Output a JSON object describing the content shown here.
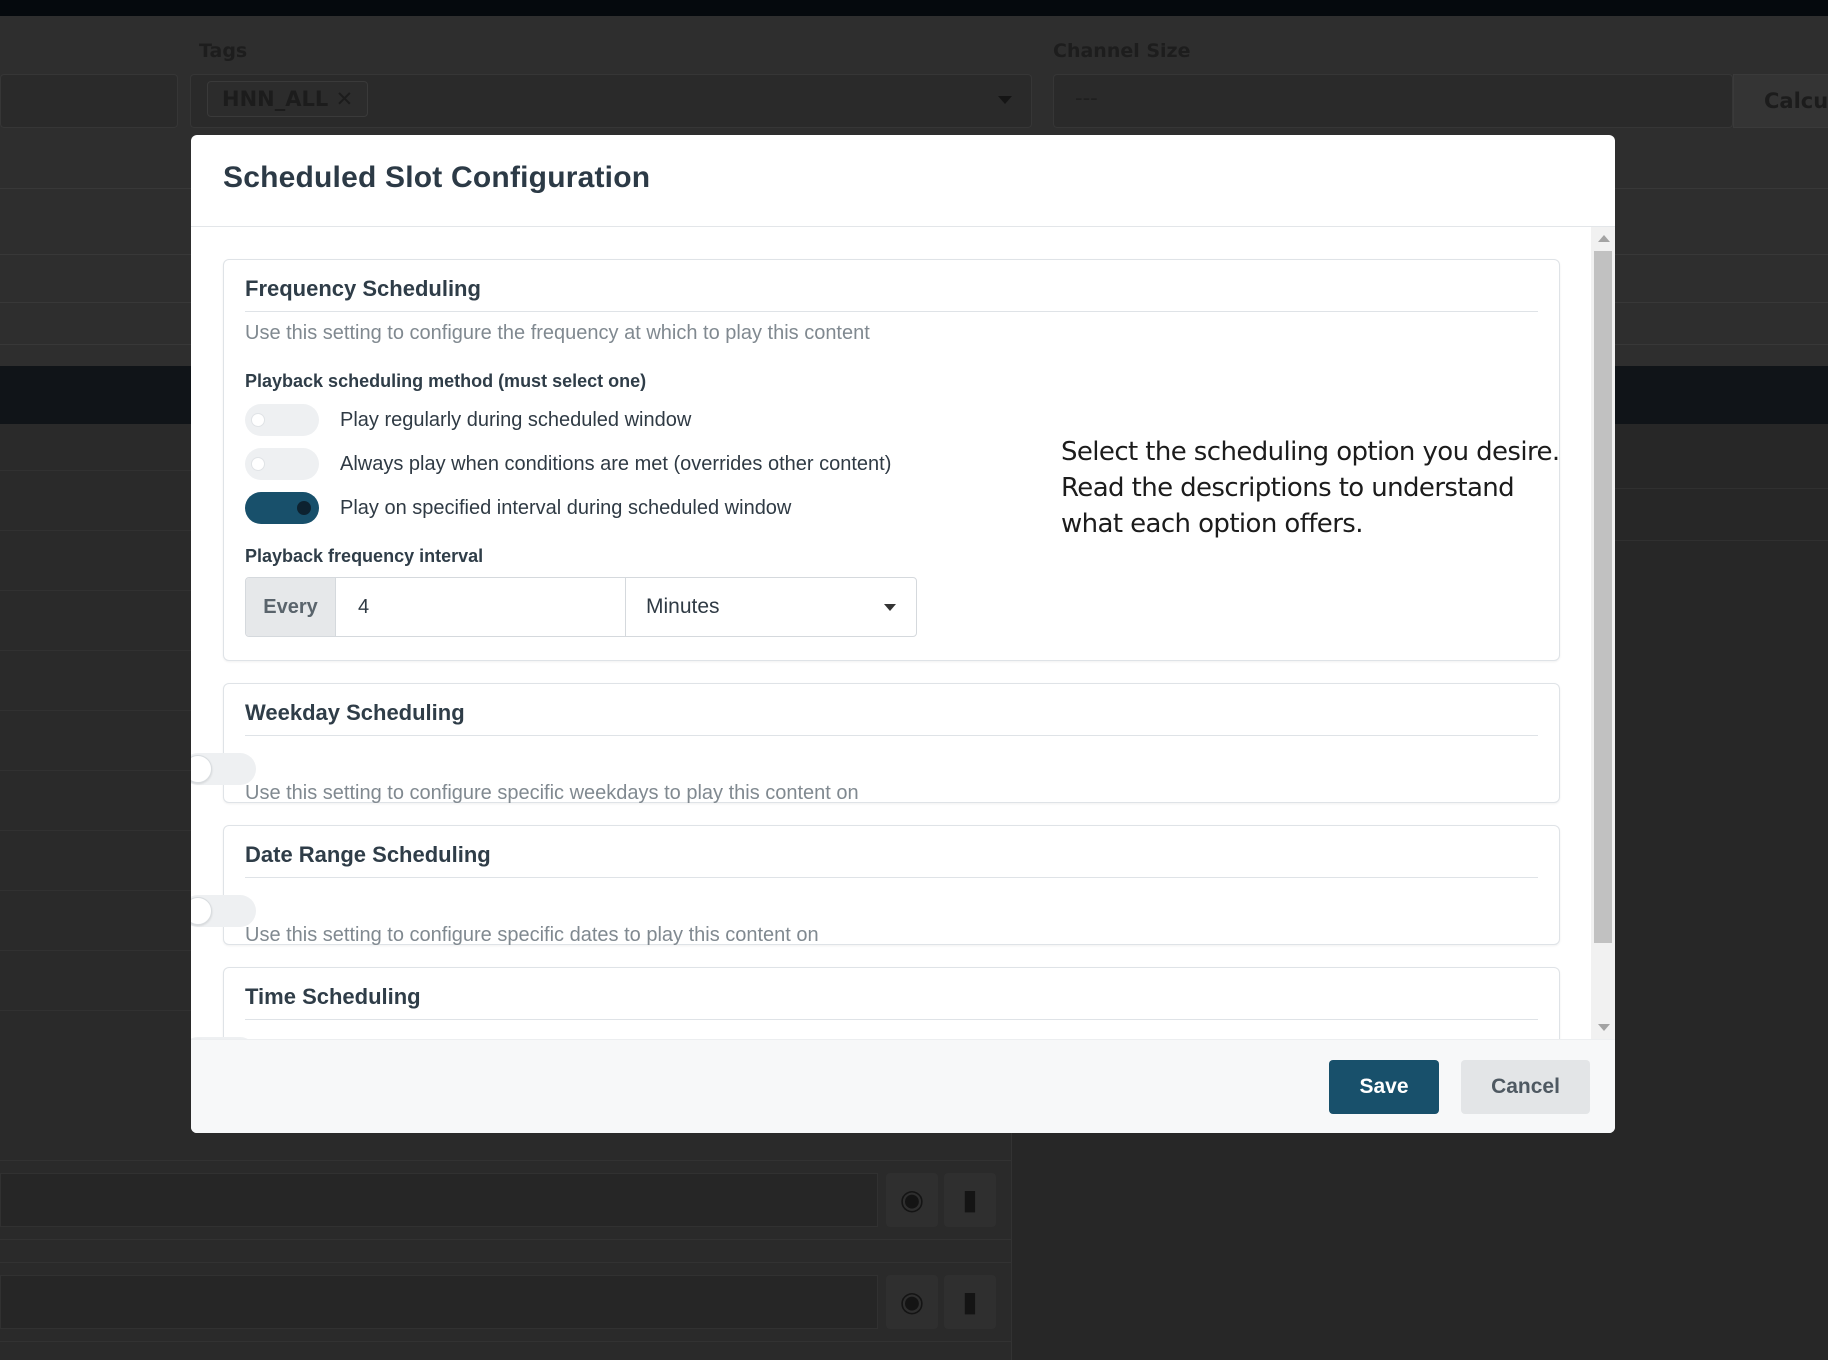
{
  "background": {
    "tags_label": "Tags",
    "tag_chip": "HNN_ALL",
    "tag_remove_glyph": "✕",
    "channel_size_label": "Channel Size",
    "channel_size_value": "---",
    "calculate_button": "Calcul",
    "row_icons": [
      "eye-icon",
      "trash-icon"
    ]
  },
  "modal": {
    "title": "Scheduled Slot Configuration",
    "frequency": {
      "title": "Frequency Scheduling",
      "description": "Use this setting to configure the frequency at which to play this content",
      "method_label": "Playback scheduling method (must select one)",
      "options": [
        {
          "label": "Play regularly during scheduled window",
          "enabled": false
        },
        {
          "label": "Always play when conditions are met (overrides other content)",
          "enabled": false
        },
        {
          "label": "Play on specified interval during scheduled window",
          "enabled": true
        }
      ],
      "interval_label": "Playback frequency interval",
      "interval_prefix": "Every",
      "interval_value": "4",
      "interval_unit": "Minutes",
      "hint": "Select the scheduling option you desire. Read the descriptions to understand what each option offers."
    },
    "weekday": {
      "title": "Weekday Scheduling",
      "description": "Use this setting to configure specific weekdays to play this content on",
      "enabled": false
    },
    "date_range": {
      "title": "Date Range Scheduling",
      "description": "Use this setting to configure specific dates to play this content on",
      "enabled": false
    },
    "time": {
      "title": "Time Scheduling",
      "enabled": false
    },
    "footer": {
      "save_label": "Save",
      "cancel_label": "Cancel"
    }
  },
  "colors": {
    "primary": "#18506b",
    "overlay": "#2b2b2b"
  }
}
